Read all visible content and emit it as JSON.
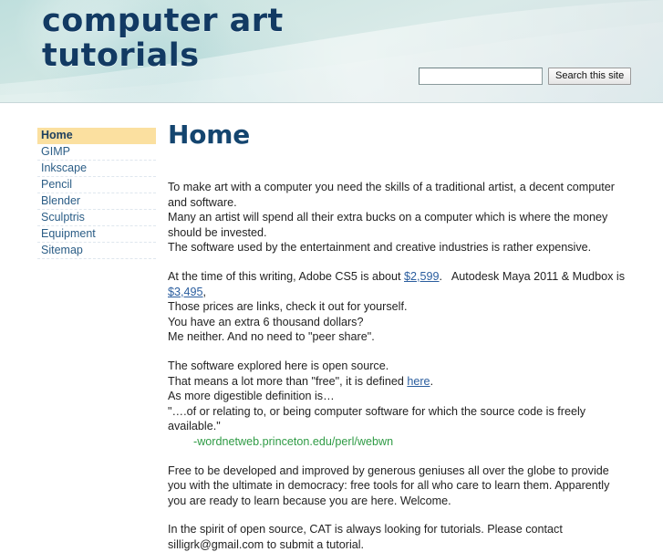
{
  "header": {
    "title_line1": "computer art",
    "title_line2": "tutorials",
    "search": {
      "value": "",
      "placeholder": "",
      "button_label": "Search this site"
    },
    "colors": {
      "gradient_left": "#bfdfdd",
      "gradient_right": "#cfe0e4",
      "title_color": "#123a63"
    }
  },
  "sidebar": {
    "items": [
      {
        "label": "Home",
        "selected": true
      },
      {
        "label": "GIMP",
        "selected": false
      },
      {
        "label": "Inkscape",
        "selected": false
      },
      {
        "label": "Pencil",
        "selected": false
      },
      {
        "label": "Blender",
        "selected": false
      },
      {
        "label": "Sculptris",
        "selected": false
      },
      {
        "label": "Equipment",
        "selected": false
      },
      {
        "label": "Sitemap",
        "selected": false
      }
    ],
    "highlight_color": "#fbe0a0",
    "link_color": "#2b5d86"
  },
  "main": {
    "page_title": "Home",
    "p1": {
      "l1": "To make art with a computer you need the skills of a traditional artist, a decent computer and software.",
      "l2": "Many an artist will spend all their extra bucks on a computer which is where the money should be invested.",
      "l3": "The software used by the entertainment and creative industries is rather expensive."
    },
    "p2": {
      "l1_a": "At the time of this writing, Adobe CS5 is about ",
      "link_cs5": "$2,599",
      "l1_b": ".   Autodesk Maya 2011 & Mudbox is ",
      "link_maya": "$3,495",
      "l1_c": ",",
      "l2": "Those prices are links, check it out for yourself.",
      "l3": "You have an extra 6 thousand dollars?",
      "l4": "Me neither. And no need to \"peer share\"."
    },
    "p3": {
      "l1": "The software explored here is open source.",
      "l2_a": "That means a lot more than \"free\", it is defined ",
      "link_here": "here",
      "l2_b": ".",
      "l3": "As more digestible definition is…",
      "l4": "\"….of or relating to, or being computer software for which the source code is freely available.\"",
      "attribution": "-wordnetweb.princeton.edu/perl/webwn"
    },
    "p4": "Free to be developed and improved by generous geniuses all over the globe to provide you with the ultimate in democracy: free tools for all who care to learn them. Apparently you are ready to learn because you are here. Welcome.",
    "p5": "In the spirit of open source, CAT is always looking for tutorials. Please contact silligrk@gmail.com to submit a tutorial.",
    "colors": {
      "title_color": "#14456f",
      "link_color": "#2a5d9e",
      "attribution_color": "#2f9b45"
    }
  }
}
